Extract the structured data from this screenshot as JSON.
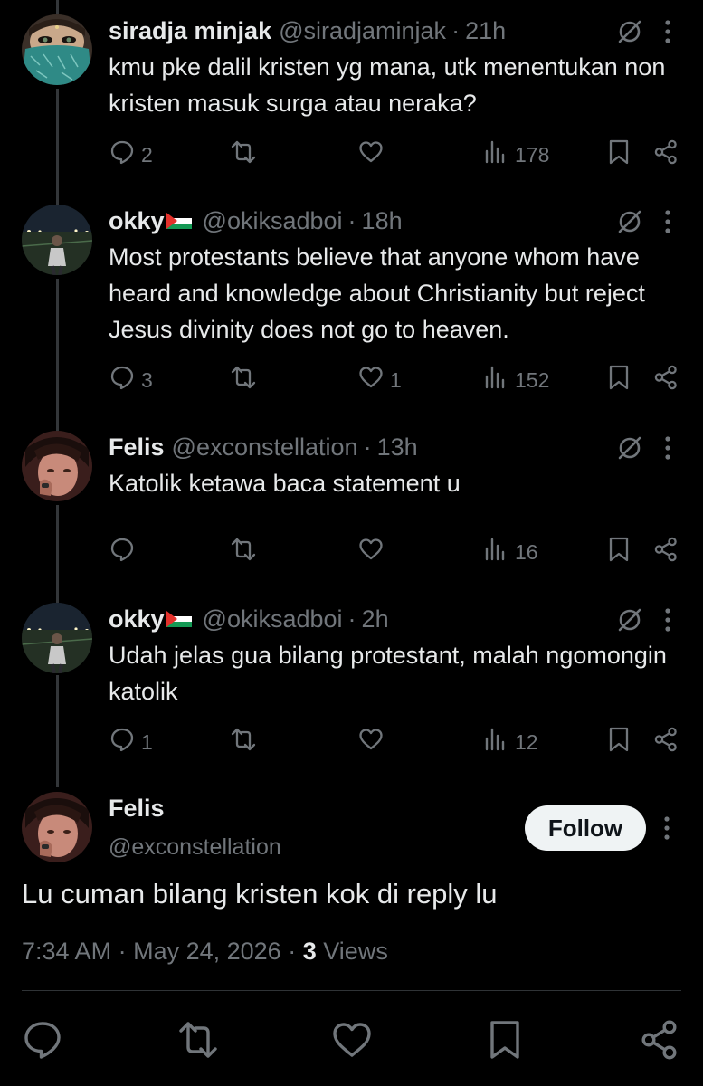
{
  "replies": [
    {
      "name": "siradja minjak",
      "handle": "@siradjaminjak",
      "time": "21h",
      "text": "kmu pke dalil kristen yg mana, utk menentukan non kristen masuk surga atau neraka?",
      "replies": "2",
      "reposts": "",
      "likes": "",
      "views": "178"
    },
    {
      "name": "okky",
      "handle": "@okiksadboi",
      "time": "18h",
      "text": "Most protestants believe that anyone whom have heard and knowledge about Christianity but reject Jesus divinity does not go to heaven.",
      "replies": "3",
      "reposts": "",
      "likes": "1",
      "views": "152"
    },
    {
      "name": "Felis",
      "handle": "@exconstellation",
      "time": "13h",
      "text": "Katolik ketawa baca statement u",
      "replies": "",
      "reposts": "",
      "likes": "",
      "views": "16"
    },
    {
      "name": "okky",
      "handle": "@okiksadboi",
      "time": "2h",
      "text": "Udah jelas gua bilang protestant, malah ngomongin katolik",
      "replies": "1",
      "reposts": "",
      "likes": "",
      "views": "12"
    }
  ],
  "main": {
    "name": "Felis",
    "handle": "@exconstellation",
    "follow_label": "Follow",
    "text": "Lu cuman bilang kristen kok di reply lu",
    "time": "7:34 AM",
    "date": "May 24, 2026",
    "views_count": "3",
    "views_label": "Views"
  },
  "separator": "·",
  "colors": {
    "background": "#000000",
    "text": "#e7e9ea",
    "muted": "#71767b",
    "follow_bg": "#eff3f4"
  },
  "icons": [
    "reply-icon",
    "repost-icon",
    "like-icon",
    "views-icon",
    "bookmark-icon",
    "share-icon",
    "grok-icon",
    "more-icon",
    "palestine-flag-icon"
  ]
}
